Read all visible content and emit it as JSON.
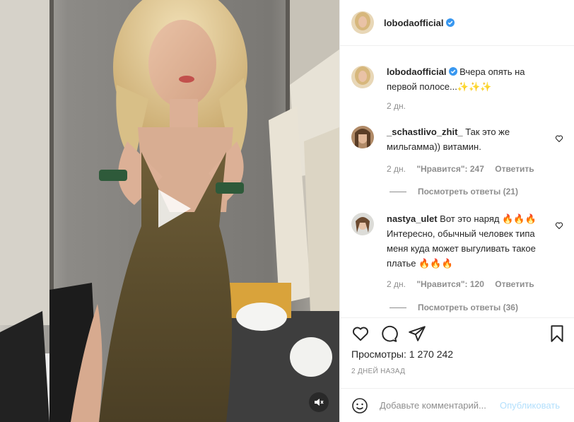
{
  "post": {
    "author": "lobodaofficial",
    "verified_icon": "verified-badge-icon",
    "caption": "Вчера опять на первой полосе...✨✨✨",
    "caption_age": "2 дн."
  },
  "media": {
    "type": "video",
    "play_icon": "play-icon",
    "mute_icon": "speaker-muted-icon"
  },
  "comments": [
    {
      "username": "_schastlivo_zhit_",
      "text": "Так это же мильгамма)) витамин.",
      "age": "2 дн.",
      "likes": "\"Нравится\": 247",
      "reply": "Ответить",
      "view_replies": "Посмотреть ответы (21)"
    },
    {
      "username": "nastya_ulet",
      "text": "Вот это наряд 🔥🔥🔥 Интересно, обычный человек типа меня куда может выгуливать такое платье 🔥🔥🔥",
      "age": "2 дн.",
      "likes": "\"Нравится\": 120",
      "reply": "Ответить",
      "view_replies": "Посмотреть ответы (36)"
    }
  ],
  "actions": {
    "like_icon": "heart-icon",
    "comment_icon": "comment-icon",
    "share_icon": "share-icon",
    "save_icon": "bookmark-icon",
    "views_label": "Просмотры:",
    "views_count": "1 270 242",
    "timestamp": "2 ДНЕЙ НАЗАД"
  },
  "add_comment": {
    "emoji_icon": "smiley-icon",
    "placeholder": "Добавьте комментарий...",
    "post_label": "Опубликовать"
  },
  "colors": {
    "verified": "#3897f0",
    "post_button_disabled": "#b2dffc",
    "muted_text": "#8e8e8e"
  }
}
